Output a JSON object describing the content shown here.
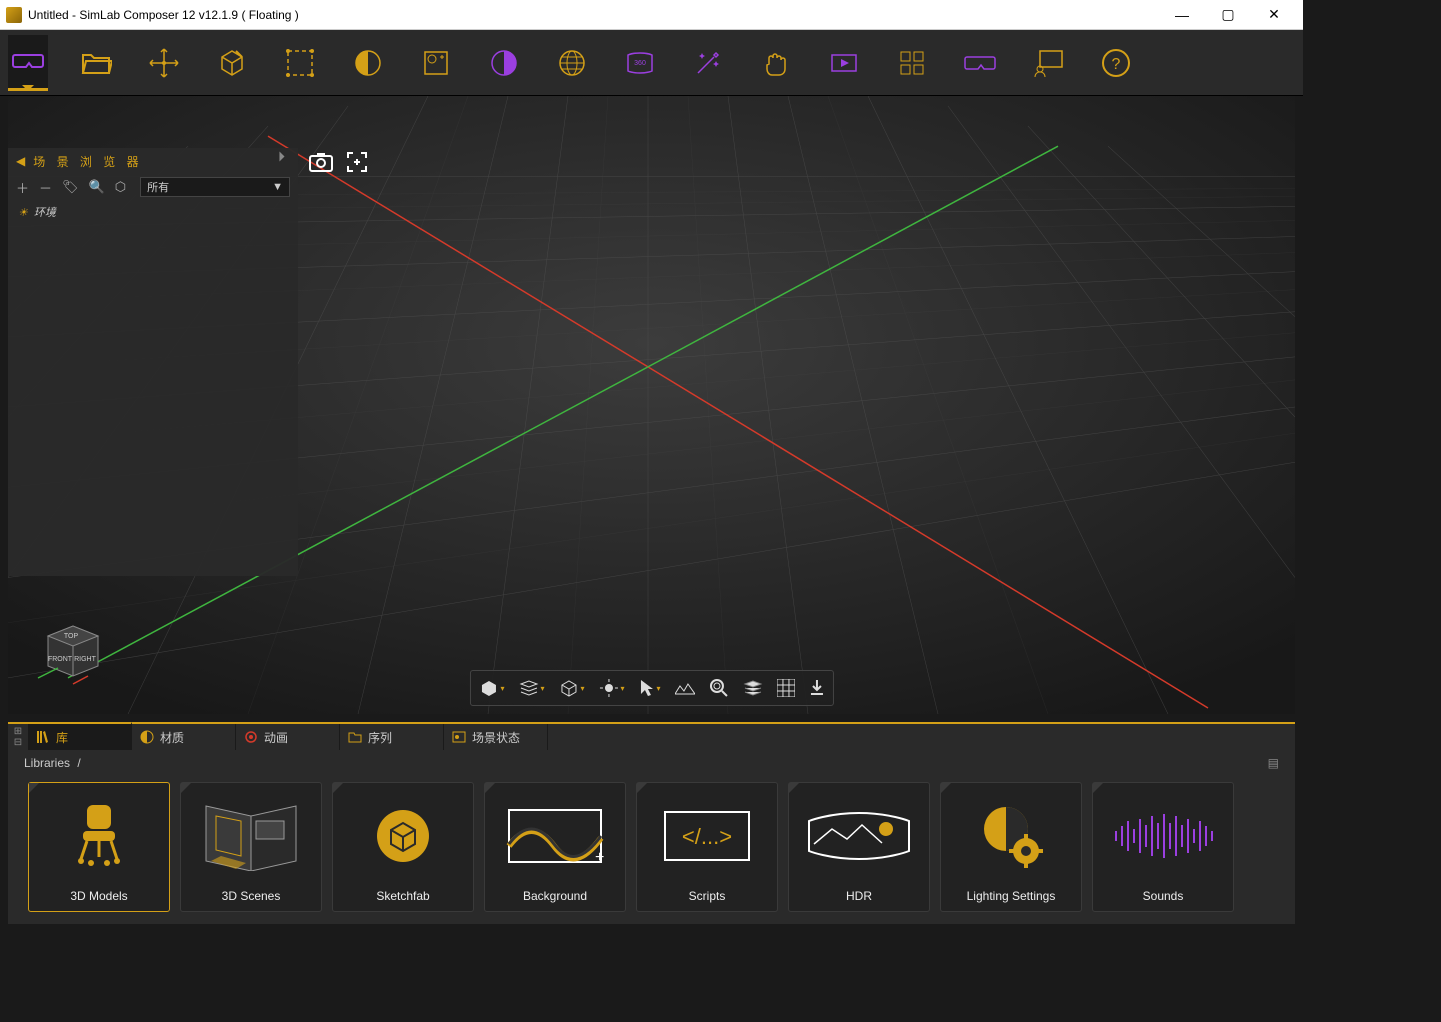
{
  "window": {
    "title": "Untitled - SimLab Composer 12 v12.1.9 ( Floating )"
  },
  "scene_panel": {
    "title": "场 景 浏 览 器",
    "filter_selected": "所有",
    "items": [
      {
        "label": "环境"
      }
    ]
  },
  "viewcube": {
    "top": "TOP",
    "front": "FRONT",
    "right": "RIGHT"
  },
  "dock": {
    "tabs": [
      {
        "label": "库"
      },
      {
        "label": "材质"
      },
      {
        "label": "动画"
      },
      {
        "label": "序列"
      },
      {
        "label": "场景状态"
      }
    ],
    "breadcrumb": [
      "Libraries",
      "/"
    ],
    "cards": [
      {
        "label": "3D Models"
      },
      {
        "label": "3D Scenes"
      },
      {
        "label": "Sketchfab"
      },
      {
        "label": "Background"
      },
      {
        "label": "Scripts"
      },
      {
        "label": "HDR"
      },
      {
        "label": "Lighting Settings"
      },
      {
        "label": "Sounds"
      }
    ]
  },
  "colors": {
    "accent": "#d4a017",
    "purple": "#9b3fe0",
    "axis_x": "#d43a2a",
    "axis_y": "#3fb53f"
  }
}
